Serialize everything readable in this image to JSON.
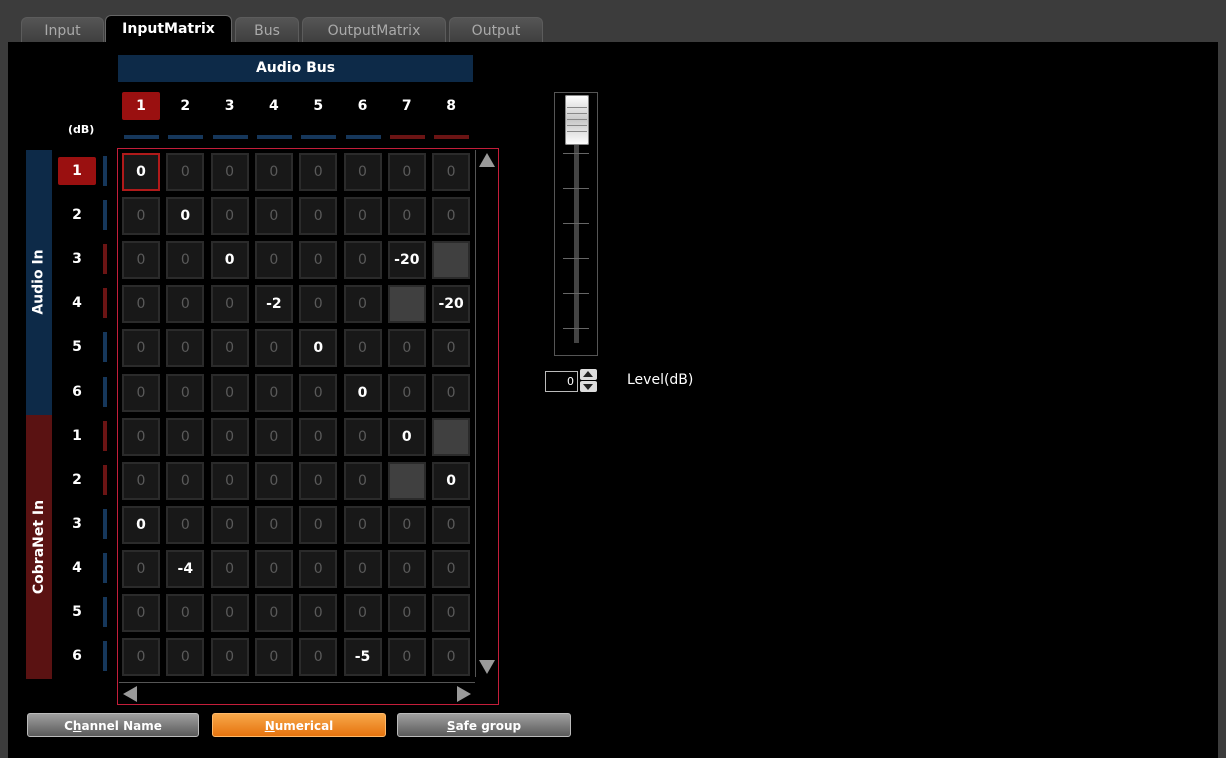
{
  "tabs": [
    {
      "label": "Input",
      "active": false
    },
    {
      "label": "InputMatrix",
      "active": true
    },
    {
      "label": "Bus",
      "active": false
    },
    {
      "label": "OutputMatrix",
      "active": false
    },
    {
      "label": "Output",
      "active": false
    }
  ],
  "bus_header": "Audio Bus",
  "db_label": "(dB)",
  "columns": [
    "1",
    "2",
    "3",
    "4",
    "5",
    "6",
    "7",
    "8"
  ],
  "selected_column": 0,
  "column_bar_colors": [
    "blue",
    "blue",
    "blue",
    "blue",
    "blue",
    "blue",
    "red",
    "red"
  ],
  "groups": [
    {
      "label": "Audio In",
      "color": "#0d2a48",
      "rows": [
        "1",
        "2",
        "3",
        "4",
        "5",
        "6"
      ]
    },
    {
      "label": "CobraNet In",
      "color": "#5a1212",
      "rows": [
        "1",
        "2",
        "3",
        "4",
        "5",
        "6"
      ]
    }
  ],
  "row_bar_colors": [
    "blue",
    "blue",
    "red",
    "red",
    "blue",
    "blue",
    "red",
    "red",
    "blue",
    "blue",
    "blue",
    "blue"
  ],
  "selected_row": 0,
  "matrix": [
    [
      "0",
      "0",
      "0",
      "0",
      "0",
      "0",
      "0",
      "0"
    ],
    [
      "0",
      "0",
      "0",
      "0",
      "0",
      "0",
      "0",
      "0"
    ],
    [
      "0",
      "0",
      "0",
      "0",
      "0",
      "0",
      "-20",
      ""
    ],
    [
      "0",
      "0",
      "0",
      "-2",
      "0",
      "0",
      "",
      "-20"
    ],
    [
      "0",
      "0",
      "0",
      "0",
      "0",
      "0",
      "0",
      "0"
    ],
    [
      "0",
      "0",
      "0",
      "0",
      "0",
      "0",
      "0",
      "0"
    ],
    [
      "0",
      "0",
      "0",
      "0",
      "0",
      "0",
      "0",
      ""
    ],
    [
      "0",
      "0",
      "0",
      "0",
      "0",
      "0",
      "",
      "0"
    ],
    [
      "0",
      "0",
      "0",
      "0",
      "0",
      "0",
      "0",
      "0"
    ],
    [
      "0",
      "-4",
      "0",
      "0",
      "0",
      "0",
      "0",
      "0"
    ],
    [
      "0",
      "0",
      "0",
      "0",
      "0",
      "0",
      "0",
      "0"
    ],
    [
      "0",
      "0",
      "0",
      "0",
      "0",
      "-5",
      "0",
      "0"
    ]
  ],
  "highlighted": [
    [
      0,
      0
    ],
    [
      1,
      1
    ],
    [
      2,
      2
    ],
    [
      2,
      6
    ],
    [
      3,
      3
    ],
    [
      3,
      7
    ],
    [
      4,
      4
    ],
    [
      5,
      5
    ],
    [
      6,
      6
    ],
    [
      7,
      7
    ],
    [
      8,
      0
    ],
    [
      9,
      1
    ],
    [
      11,
      5
    ]
  ],
  "gray_cells": [
    [
      2,
      7
    ],
    [
      3,
      6
    ],
    [
      6,
      7
    ],
    [
      7,
      6
    ]
  ],
  "selected_cell": [
    0,
    0
  ],
  "buttons": {
    "channel_name": {
      "pre": "C",
      "ul": "h",
      "post": "annel Name"
    },
    "numerical": {
      "pre": "",
      "ul": "N",
      "post": "umerical"
    },
    "safe_group": {
      "pre": "",
      "ul": "S",
      "post": "afe group"
    }
  },
  "fader": {
    "level_value": "0",
    "level_label": "Level(dB)",
    "position": 1.0
  },
  "colors": {
    "accent_orange": "#e6730e",
    "select_red": "#9a1010",
    "matrix_border": "#c41e3a",
    "bus_blue": "#0d2a48"
  }
}
